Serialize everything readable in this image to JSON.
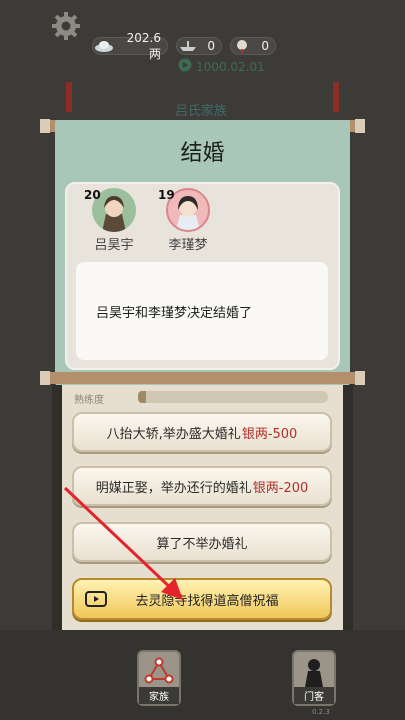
{
  "top": {
    "silver": "202.6两",
    "stat_a": "0",
    "stat_b": "0",
    "timer": "1000.02.01",
    "bg_title": "吕氏家族"
  },
  "modal": {
    "title": "结婚",
    "person1": {
      "age": "20",
      "name": "吕昊宇"
    },
    "person2": {
      "age": "19",
      "name": "李瑾梦"
    },
    "message": "吕昊宇和李瑾梦决定结婚了"
  },
  "skill": {
    "label": "熟练度"
  },
  "options": [
    {
      "text": "八抬大轿,举办盛大婚礼",
      "cost": "银两-500"
    },
    {
      "text": "明媒正娶，举办还行的婚礼",
      "cost": "银两-200"
    },
    {
      "text": "算了不举办婚礼",
      "cost": ""
    }
  ],
  "gold_button": {
    "text": "去灵隐寺找得道高僧祝福"
  },
  "nav": {
    "family": "家族",
    "sect": "门客",
    "version": "0.2.3"
  },
  "colors": {
    "cost": "#b0302a",
    "modal_bg": "#a8c7b8"
  }
}
